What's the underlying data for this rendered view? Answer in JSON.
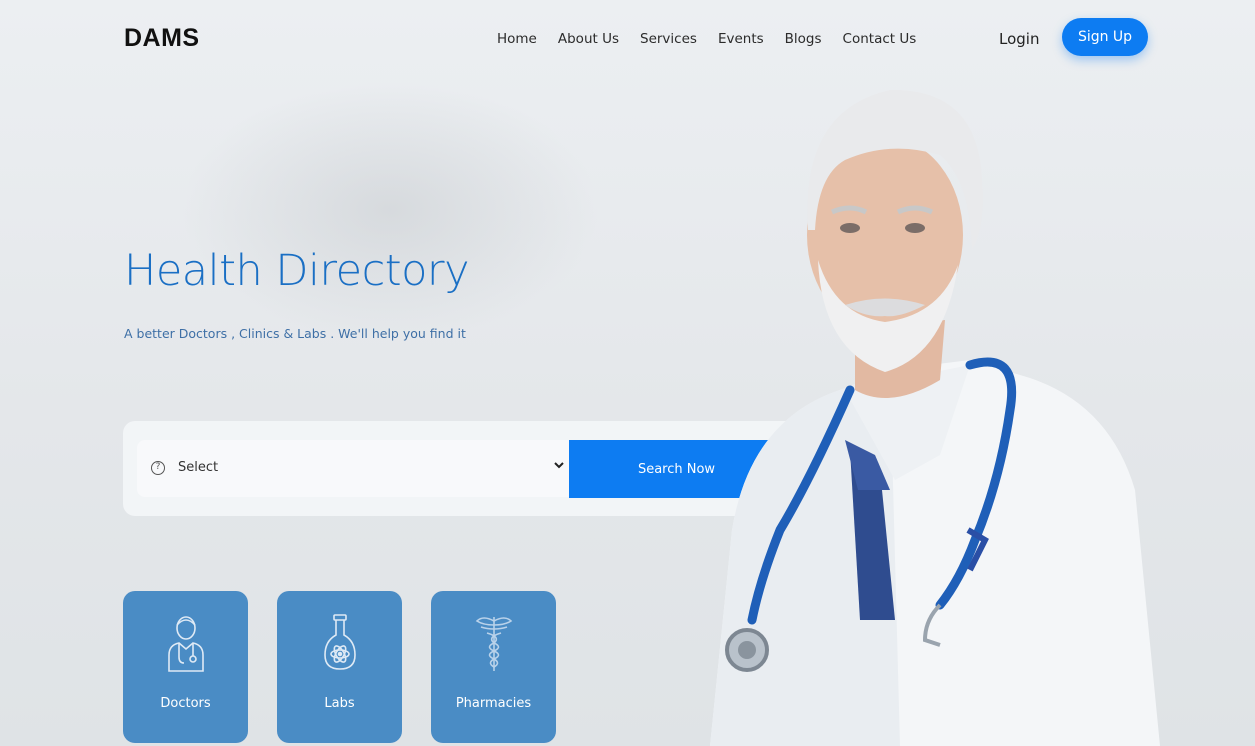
{
  "brand": {
    "logo": "DAMS"
  },
  "nav": {
    "links": [
      "Home",
      "About Us",
      "Services",
      "Events",
      "Blogs",
      "Contact Us"
    ],
    "login": "Login",
    "signup": "Sign Up"
  },
  "hero": {
    "title": "Health Directory",
    "subtitle": "A better Doctors , Clinics & Labs . We'll help you find it"
  },
  "search": {
    "select_value": "Select",
    "button": "Search Now",
    "icon": "question-circle-icon"
  },
  "categories": [
    {
      "label": "Doctors",
      "icon": "doctor-icon"
    },
    {
      "label": "Labs",
      "icon": "flask-icon"
    },
    {
      "label": "Pharmacies",
      "icon": "caduceus-icon"
    }
  ],
  "colors": {
    "accent": "#0d7cf2",
    "title": "#1a6fc4",
    "card": "#4a8cc5"
  }
}
